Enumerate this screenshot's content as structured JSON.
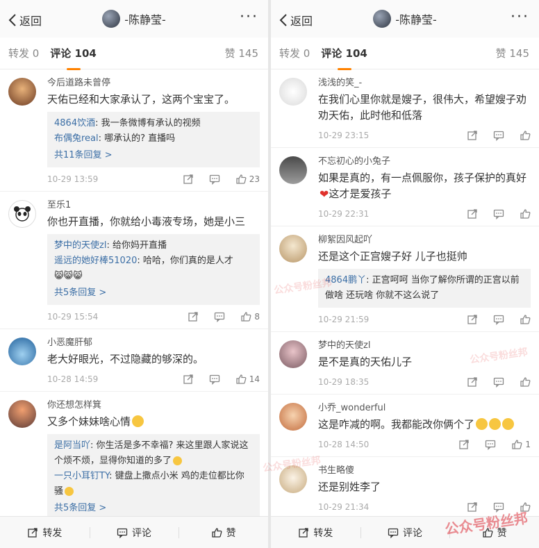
{
  "left": {
    "nav": {
      "back_label": "返回",
      "title": "-陈静莹-",
      "more_label": "···"
    },
    "tabs": {
      "repost": "转发 0",
      "comments": "评论 104",
      "likes": "赞 145"
    },
    "comments": [
      {
        "user": "今后道路未曾停",
        "text": "天佑已经和大家承认了，这两个宝宝了。",
        "replies": [
          {
            "user": "4864饮酒",
            "text": ": 我一条微博有承认的视频"
          },
          {
            "user": "布偶兔real",
            "text": ": 哪承认的? 直播吗"
          }
        ],
        "more": "共11条回复 >",
        "time": "10-29 13:59",
        "like_count": "23",
        "avatar_color": "#8c5a3c"
      },
      {
        "user": "至乐1",
        "text": "你也开直播，你就给小毒液专场，她是小三",
        "replies": [
          {
            "user": "梦中的天使zl",
            "text": ": 给你妈开直播"
          },
          {
            "user": "遥远的她好棒51020",
            "text": ": 哈哈，你们真的是人才"
          }
        ],
        "reply_emojis": "😸😸😸",
        "more": "共5条回复 >",
        "time": "10-29 15:54",
        "like_count": "8",
        "avatar_color": "#ffffff"
      },
      {
        "user": "小恶魔肝郁",
        "text": "老大好眼光，不过隐藏的够深的。",
        "time": "10-28 14:59",
        "like_count": "14",
        "avatar_color": "#3b7bbd"
      },
      {
        "user": "你还想怎样箕",
        "text": "又多个妹妹啥心情",
        "replies": [
          {
            "user": "是阿当吖",
            "text": ": 你生活是多不幸福? 来这里跟人家说这个烦不烦，显得你知道的多了"
          },
          {
            "user": "一只小耳钉TY",
            "text": ": 键盘上撒点小米 鸡的走位都比你骚"
          }
        ],
        "more": "共5条回复 >",
        "avatar_color": "#c0644a"
      }
    ],
    "bottom": {
      "repost": "转发",
      "comment": "评论",
      "like": "赞"
    }
  },
  "right": {
    "nav": {
      "back_label": "返回",
      "title": "-陈静莹-",
      "more_label": "···"
    },
    "tabs": {
      "repost": "转发 0",
      "comments": "评论 104",
      "likes": "赞 145"
    },
    "comments": [
      {
        "user": "浅浅的笑_-",
        "text": "在我们心里你就是嫂子，很伟大，希望嫂子劝劝天佑，此时他和低落",
        "time": "10-29 23:15",
        "avatar_color": "#eeeeee"
      },
      {
        "user": "不忘初心的小兔子",
        "text": "如果是真的，有一点佩服你，孩子保护的真好",
        "text2": "这才是爱孩子",
        "time": "10-29 22:31",
        "avatar_color": "#6e6e6e"
      },
      {
        "user": "柳絮因风起吖",
        "text": "还是这个正宫嫂子好 儿子也挺帅",
        "replies": [
          {
            "user": "4864鹏丫",
            "text": ": 正宫呵呵 当你了解你所谓的正宫以前做啥 还玩啥 你就不这么说了"
          }
        ],
        "time": "10-29 21:59",
        "avatar_color": "#d8c29a"
      },
      {
        "user": "梦中的天使zl",
        "text": "是不是真的天佑儿子",
        "time": "10-29 18:35",
        "avatar_color": "#b98a8f"
      },
      {
        "user": "小乔_wonderful",
        "text": "这是咋减的啊。我都能改你俩个了",
        "time": "10-28 14:50",
        "like_count": "1",
        "avatar_color": "#d9a06b"
      },
      {
        "user": "书生略傻",
        "text": "还是别姓李了",
        "time": "10-29 21:34",
        "avatar_color": "#e9dcc8"
      }
    ],
    "bottom": {
      "repost": "转发",
      "comment": "评论",
      "like": "赞"
    },
    "watermark_big": "公众号粉丝邦"
  },
  "watermark": "公众号粉丝邦",
  "colors": {
    "accent": "#ff8200",
    "link": "#3b6ea5"
  }
}
